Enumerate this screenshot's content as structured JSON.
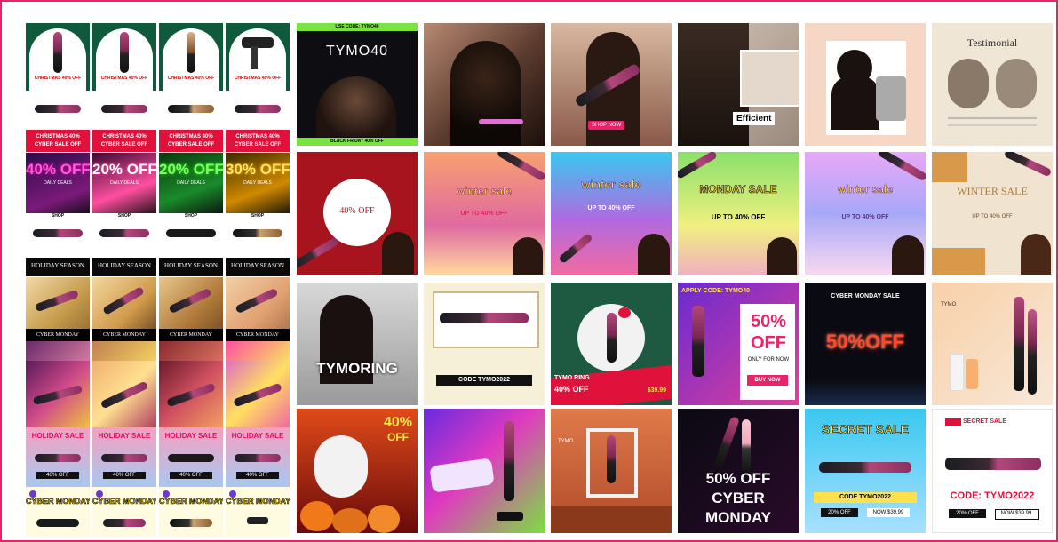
{
  "left": {
    "christmas": {
      "top": "CHRISTMAS 40% OFF",
      "mid": "CYBER SALE OFF",
      "bottom": [
        "CHRISTMAS 40%",
        "CYBER SALE OFF"
      ]
    },
    "neon": {
      "badges": [
        "40% OFF",
        "20% OFF",
        "20% OFF",
        "30% OFF"
      ],
      "tagline": "DAILY DEALS",
      "cta": "SHOP",
      "footer": "HOLIDAY SEASON"
    },
    "lux": {
      "label": "CYBER MONDAY"
    },
    "pink": {
      "head": "HOLIDAY SALE",
      "pct": "40% OFF"
    },
    "cyber": {
      "head": "CYBER MONDAY"
    }
  },
  "tiles": {
    "t1": {
      "top": "USE CODE: TYMO40",
      "brand": "TYMO40",
      "bottom": "BLACK FRIDAY 40% OFF"
    },
    "t3": {
      "pill": "SHOP NOW"
    },
    "t4": {
      "label": "Efficient"
    },
    "t6": {
      "title": "Testimonial"
    },
    "r2c1": {
      "text": "40% OFF"
    },
    "r2c2": {
      "head": "winter sale",
      "sub": "UP TO 40% OFF"
    },
    "r2c3": {
      "head": "winter sale",
      "sub": "UP TO 40% OFF"
    },
    "r2c4": {
      "head": "MONDAY SALE",
      "sub": "UP TO 40% OFF"
    },
    "r2c5": {
      "head": "winter sale",
      "sub": "UP TO 40% OFF"
    },
    "r2c6": {
      "head": "WINTER SALE",
      "sub": "UP TO 40% OFF"
    },
    "r3c1": {
      "text": "TYMORING"
    },
    "r3c2": {
      "code": "CODE TYMO2022"
    },
    "r3c3": {
      "title": "TYMO RING",
      "pct": "40% OFF",
      "price": "$39.99"
    },
    "r3c4": {
      "apply": "APPLY CODE: TYMO40",
      "pct": "50%",
      "off": "OFF",
      "sub": "ONLY FOR NOW",
      "cta": "BUY NOW"
    },
    "r3c5": {
      "title": "CYBER MONDAY SALE",
      "pct": "50%OFF"
    },
    "r3c6": {
      "brand": "TYMO"
    },
    "r4c1": {
      "pct": "40%",
      "off": "OFF"
    },
    "r4c3": {
      "label": "TYMO"
    },
    "r4c4": {
      "pct": "50% OFF",
      "l2": "CYBER",
      "l3": "MONDAY"
    },
    "r4c5": {
      "head": "SECRET SALE",
      "code": "CODE TYMO2022",
      "left": "20% OFF",
      "right": "NOW $39.99"
    },
    "r4c6": {
      "flag": "SECRET SALE",
      "code": "CODE: TYMO2022",
      "left": "20% OFF",
      "right": "NOW $39.99"
    }
  },
  "colors": {
    "frame": "#e8236a",
    "accent": "#e8236a"
  }
}
